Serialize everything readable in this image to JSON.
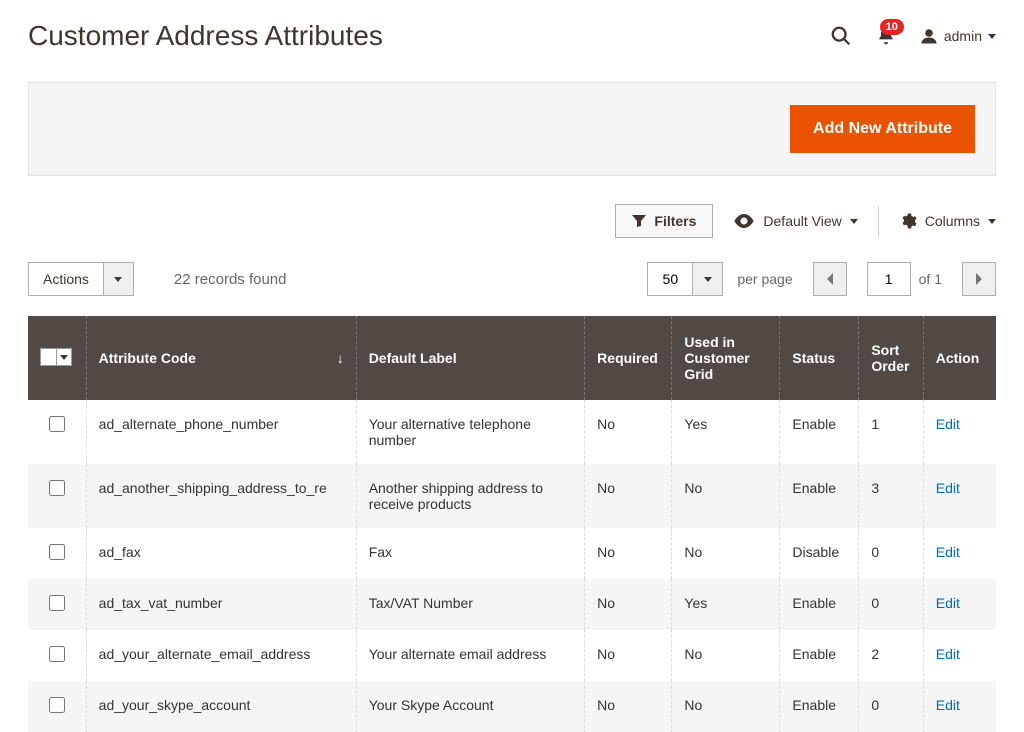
{
  "header": {
    "title": "Customer Address Attributes",
    "notification_count": "10",
    "account_label": "admin"
  },
  "action_bar": {
    "add_button": "Add New Attribute"
  },
  "toolbar": {
    "filters": "Filters",
    "default_view": "Default View",
    "columns": "Columns",
    "actions": "Actions",
    "records_found": "22 records found",
    "page_size": "50",
    "per_page": "per page",
    "current_page": "1",
    "of": "of",
    "total_pages": "1"
  },
  "table": {
    "headers": {
      "code": "Attribute Code",
      "label": "Default Label",
      "required": "Required",
      "used_in_grid": "Used in Customer Grid",
      "status": "Status",
      "sort_order": "Sort Order",
      "action": "Action"
    },
    "edit_label": "Edit",
    "rows": [
      {
        "code": "ad_alternate_phone_number",
        "label": "Your alternative telephone number",
        "required": "No",
        "used_in_grid": "Yes",
        "status": "Enable",
        "sort_order": "1"
      },
      {
        "code": "ad_another_shipping_address_to_re",
        "label": "Another shipping address to receive products",
        "required": "No",
        "used_in_grid": "No",
        "status": "Enable",
        "sort_order": "3"
      },
      {
        "code": "ad_fax",
        "label": "Fax",
        "required": "No",
        "used_in_grid": "No",
        "status": "Disable",
        "sort_order": "0"
      },
      {
        "code": "ad_tax_vat_number",
        "label": "Tax/VAT Number",
        "required": "No",
        "used_in_grid": "Yes",
        "status": "Enable",
        "sort_order": "0"
      },
      {
        "code": "ad_your_alternate_email_address",
        "label": "Your alternate email address",
        "required": "No",
        "used_in_grid": "No",
        "status": "Enable",
        "sort_order": "2"
      },
      {
        "code": "ad_your_skype_account",
        "label": "Your Skype Account",
        "required": "No",
        "used_in_grid": "No",
        "status": "Enable",
        "sort_order": "0"
      }
    ]
  }
}
